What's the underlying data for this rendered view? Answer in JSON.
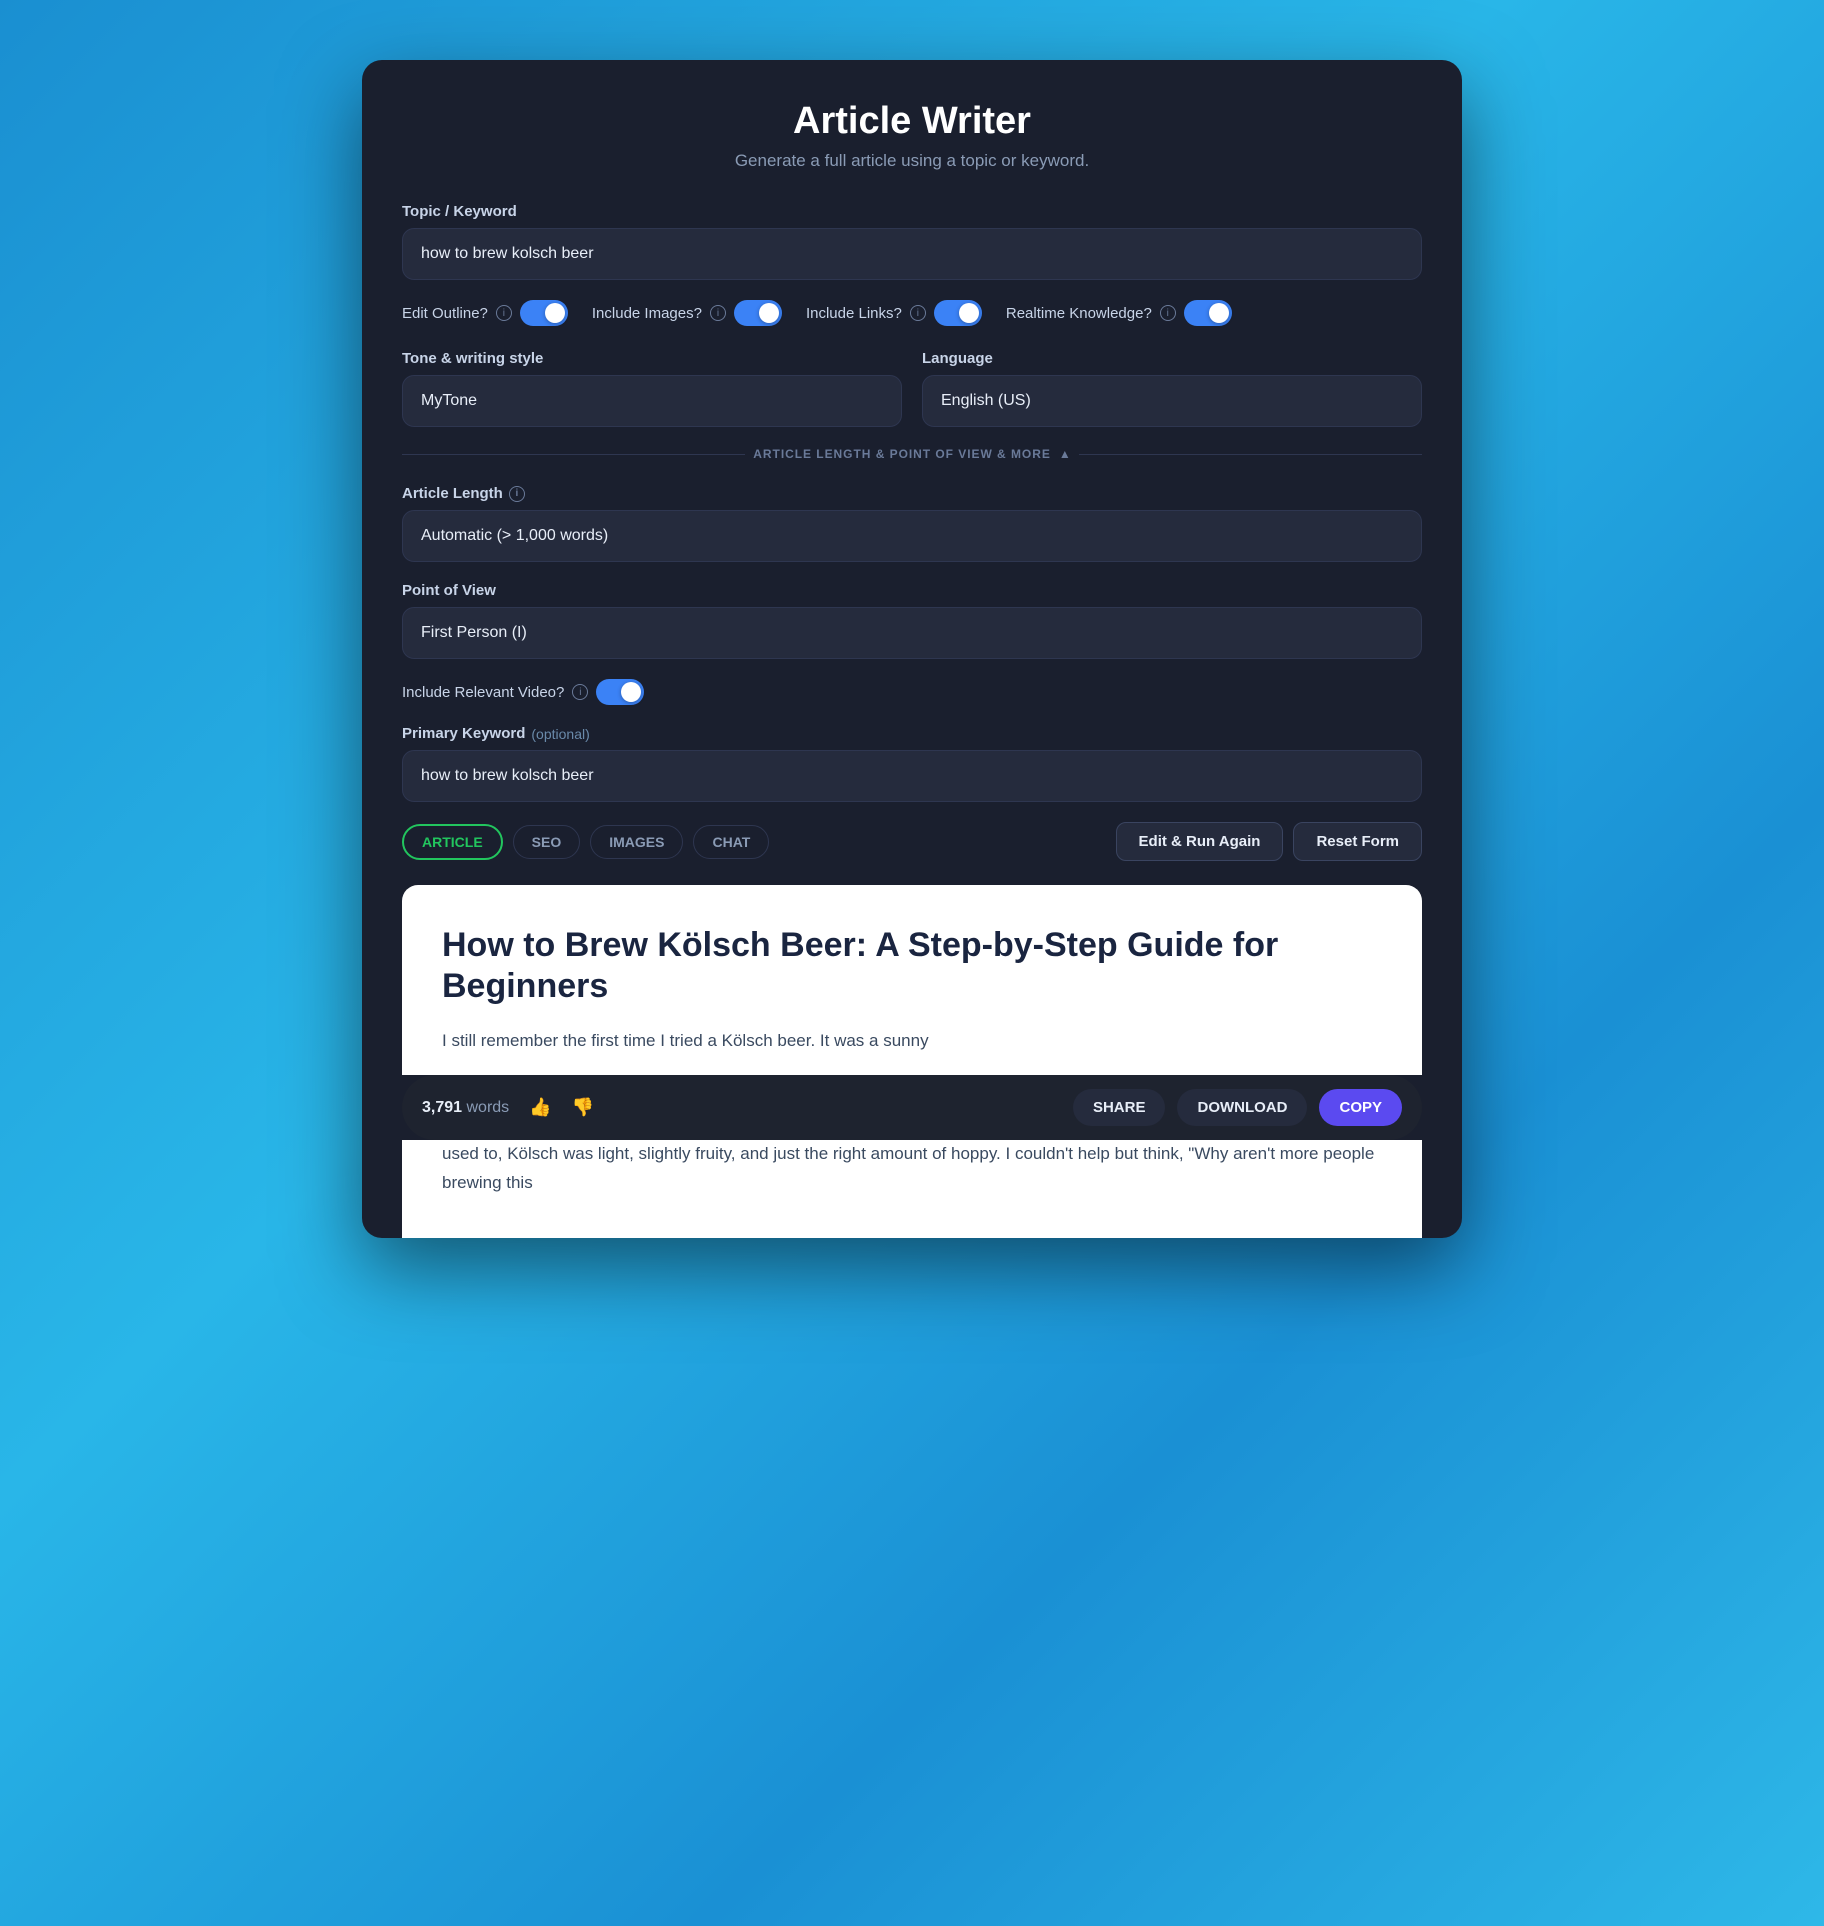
{
  "header": {
    "title": "Article Writer",
    "subtitle": "Generate a full article using a topic or keyword."
  },
  "form": {
    "topic_label": "Topic / Keyword",
    "topic_value": "how to brew kolsch beer",
    "edit_outline_label": "Edit Outline?",
    "include_images_label": "Include Images?",
    "include_links_label": "Include Links?",
    "realtime_knowledge_label": "Realtime Knowledge?",
    "tone_label": "Tone & writing style",
    "tone_value": "MyTone",
    "language_label": "Language",
    "language_value": "English (US)",
    "expander_text": "ARTICLE LENGTH & POINT OF VIEW & MORE",
    "article_length_label": "Article Length",
    "article_length_value": "Automatic (> 1,000 words)",
    "point_of_view_label": "Point of View",
    "point_of_view_value": "First Person (I)",
    "include_video_label": "Include Relevant Video?",
    "primary_keyword_label": "Primary Keyword",
    "primary_keyword_optional": "(optional)",
    "primary_keyword_value": "how to brew kolsch beer"
  },
  "tabs": {
    "items": [
      {
        "label": "ARTICLE",
        "active": true
      },
      {
        "label": "SEO",
        "active": false
      },
      {
        "label": "IMAGES",
        "active": false
      },
      {
        "label": "CHAT",
        "active": false
      }
    ]
  },
  "actions": {
    "edit_run_again": "Edit & Run Again",
    "reset_form": "Reset Form"
  },
  "article": {
    "title": "How to Brew Kölsch Beer: A Step-by-Step Guide for Beginners",
    "body1": "I still remember the first time I tried a Kölsch beer. It was a sunny",
    "body2": "used to, Kölsch was light, slightly fruity, and just the right amount of hoppy. I couldn't help but think, \"Why aren't more people brewing this"
  },
  "bottom_bar": {
    "word_count_number": "3,791",
    "word_count_label": "words",
    "share_label": "SHARE",
    "download_label": "DOWNLOAD",
    "copy_label": "COPY"
  }
}
